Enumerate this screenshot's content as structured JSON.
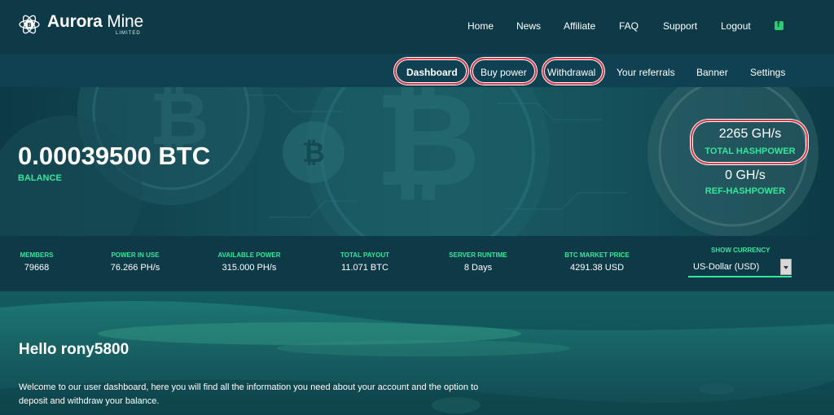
{
  "brand": {
    "name_bold": "Aurora",
    "name_rest": " Mine",
    "sub": "LIMITED"
  },
  "topnav": [
    "Home",
    "News",
    "Affiliate",
    "FAQ",
    "Support",
    "Logout"
  ],
  "subnav": [
    "Dashboard",
    "Buy power",
    "Withdrawal",
    "Your referrals",
    "Banner",
    "Settings"
  ],
  "balance": {
    "value": "0.00039500 BTC",
    "label": "BALANCE"
  },
  "hashpower": {
    "total_value": "2265 GH/s",
    "total_label": "TOTAL HASHPOWER",
    "ref_value": "0 GH/s",
    "ref_label": "REF-HASHPOWER"
  },
  "stats": [
    {
      "label": "MEMBERS",
      "value": "79668"
    },
    {
      "label": "POWER IN USE",
      "value": "76.266 PH/s"
    },
    {
      "label": "AVAILABLE POWER",
      "value": "315.000 PH/s"
    },
    {
      "label": "TOTAL PAYOUT",
      "value": "11.071 BTC"
    },
    {
      "label": "SERVER RUNTIME",
      "value": "8 Days"
    },
    {
      "label": "BTC MARKET PRICE",
      "value": "4291.38 USD"
    }
  ],
  "currency": {
    "label": "SHOW CURRENCY",
    "selected": "US-Dollar (USD)"
  },
  "welcome": {
    "greeting": "Hello rony5800",
    "text": "Welcome to our user dashboard, here you will find all the information you need about your account and the option to deposit and withdraw your balance."
  },
  "colors": {
    "accent": "#34e79a",
    "highlight_ring": "#e03a4a",
    "nav_bg": "#0e3a48"
  },
  "icons": {
    "logo": "bitcoin-atom-logo-icon",
    "social": "facebook-icon"
  }
}
